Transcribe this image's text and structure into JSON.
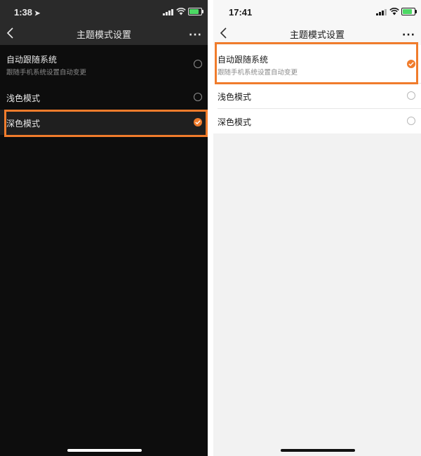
{
  "left_phone": {
    "status": {
      "time": "1:38",
      "location_arrow": "➤"
    },
    "nav": {
      "title": "主题模式设置",
      "more": "···"
    },
    "options": [
      {
        "label": "自动跟随系统",
        "sub": "跟随手机系统设置自动变更",
        "selected": false
      },
      {
        "label": "浅色模式",
        "selected": false
      },
      {
        "label": "深色模式",
        "selected": true
      }
    ]
  },
  "right_phone": {
    "status": {
      "time": "17:41"
    },
    "nav": {
      "title": "主题模式设置",
      "more": "···"
    },
    "options": [
      {
        "label": "自动跟随系统",
        "sub": "跟随手机系统设置自动变更",
        "selected": true
      },
      {
        "label": "浅色模式",
        "selected": false
      },
      {
        "label": "深色模式",
        "selected": false
      }
    ]
  },
  "colors": {
    "accent": "#f07c2c",
    "dark_bg": "#0d0d0d",
    "dark_bar": "#2a2a2a",
    "light_bg": "#f2f2f2"
  }
}
